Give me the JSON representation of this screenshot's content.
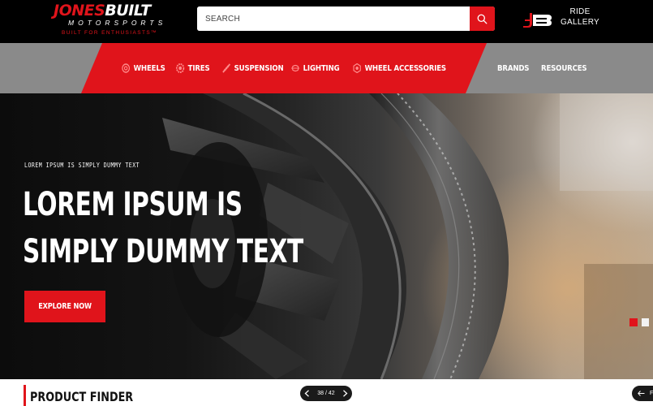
{
  "brand": {
    "logo_left": "JONES",
    "logo_right": "BUILT",
    "logo_sub": "MOTORSPORTS",
    "tagline": "BUILT FOR ENTHUSIASTS™"
  },
  "search": {
    "placeholder": "SEARCH"
  },
  "ride_gallery": {
    "line1": "RIDE",
    "line2": "GALLERY"
  },
  "nav": {
    "items": [
      {
        "label": "WHEELS",
        "icon": "wheel-icon"
      },
      {
        "label": "TIRES",
        "icon": "tire-icon"
      },
      {
        "label": "SUSPENSION",
        "icon": "suspension-icon"
      },
      {
        "label": "LIGHTING",
        "icon": "lighting-icon"
      },
      {
        "label": "WHEEL ACCESSORIES",
        "icon": "wheel-accessories-icon"
      }
    ],
    "right_items": [
      {
        "label": "BRANDS"
      },
      {
        "label": "RESOURCES"
      }
    ]
  },
  "hero": {
    "eyebrow": "LOREM IPSUM IS SIMPLY DUMMY TEXT",
    "title": "LOREM IPSUM IS SIMPLY DUMMY TEXT",
    "cta": "EXPLORE NOW",
    "slides_total": 2,
    "active_slide": 1
  },
  "product_finder": {
    "title": "PRODUCT FINDER"
  },
  "pager": {
    "current": "38",
    "total": "42",
    "label": "38 / 42"
  },
  "corner_label": "F",
  "colors": {
    "accent": "#e0141b",
    "topbar": "#000000",
    "navbar": "#8a8a8a"
  }
}
